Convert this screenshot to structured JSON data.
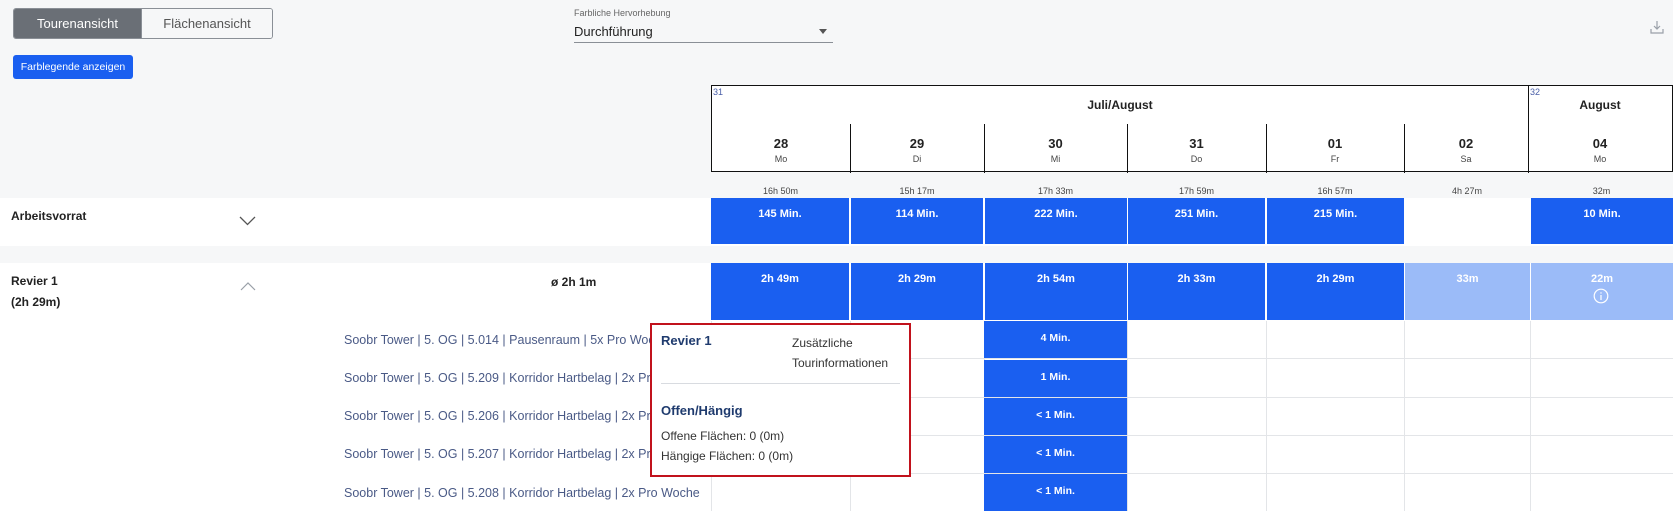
{
  "view_toggle": {
    "active": "Tourenansicht",
    "inactive": "Flächenansicht"
  },
  "highlight_select": {
    "label": "Farbliche Hervorhebung",
    "value": "Durchführung"
  },
  "legend_button": "Farblegende anzeigen",
  "icons": {
    "download": "download-icon",
    "collapse": "chevron-down-icon",
    "expand": "chevron-up-icon",
    "info": "info-icon"
  },
  "colors": {
    "accent": "#1a5ff0",
    "light_accent": "#9bbbf8",
    "popup_border": "#c1121c"
  },
  "calendar": {
    "weeks": [
      {
        "number": "31",
        "month": "Juli/August"
      },
      {
        "number": "32",
        "month": "August"
      }
    ],
    "days": [
      {
        "num": "28",
        "wd": "Mo",
        "total": "16h 50m"
      },
      {
        "num": "29",
        "wd": "Di",
        "total": "15h 17m"
      },
      {
        "num": "30",
        "wd": "Mi",
        "total": "17h 33m"
      },
      {
        "num": "31",
        "wd": "Do",
        "total": "17h 59m"
      },
      {
        "num": "01",
        "wd": "Fr",
        "total": "16h 57m"
      },
      {
        "num": "02",
        "wd": "Sa",
        "total": "4h 27m"
      },
      {
        "num": "04",
        "wd": "Mo",
        "total": "32m"
      }
    ]
  },
  "arbeitsvorrat": {
    "title": "Arbeitsvorrat",
    "cells": [
      "145 Min.",
      "114 Min.",
      "222 Min.",
      "251 Min.",
      "215 Min.",
      "",
      "10 Min."
    ]
  },
  "revier": {
    "title": "Revier 1",
    "subtitle": "(2h 29m)",
    "average": "ø 2h 1m",
    "cells": [
      "2h 49m",
      "2h 29m",
      "2h 54m",
      "2h 33m",
      "2h 29m",
      "33m",
      "22m"
    ]
  },
  "sub_rows": [
    {
      "label": "Soobr Tower | 5. OG | 5.014 | Pausenraum | 5x Pro Woche",
      "value": "4 Min."
    },
    {
      "label": "Soobr Tower | 5. OG | 5.209 | Korridor Hartbelag | 2x Pro Woche",
      "value": "1 Min."
    },
    {
      "label": "Soobr Tower | 5. OG | 5.206 | Korridor Hartbelag | 2x Pro Woche",
      "value": "< 1 Min."
    },
    {
      "label": "Soobr Tower | 5. OG | 5.207 | Korridor Hartbelag | 2x Pro Woche",
      "value": "< 1 Min."
    },
    {
      "label": "Soobr Tower | 5. OG | 5.208 | Korridor Hartbelag | 2x Pro Woche",
      "value": "< 1 Min."
    }
  ],
  "popup": {
    "title": "Revier 1",
    "info": "Zusätzliche Tourinformationen",
    "section": "Offen/Hängig",
    "open_areas": "Offene Flächen: 0 (0m)",
    "pending_areas": "Hängige Flächen: 0 (0m)"
  }
}
